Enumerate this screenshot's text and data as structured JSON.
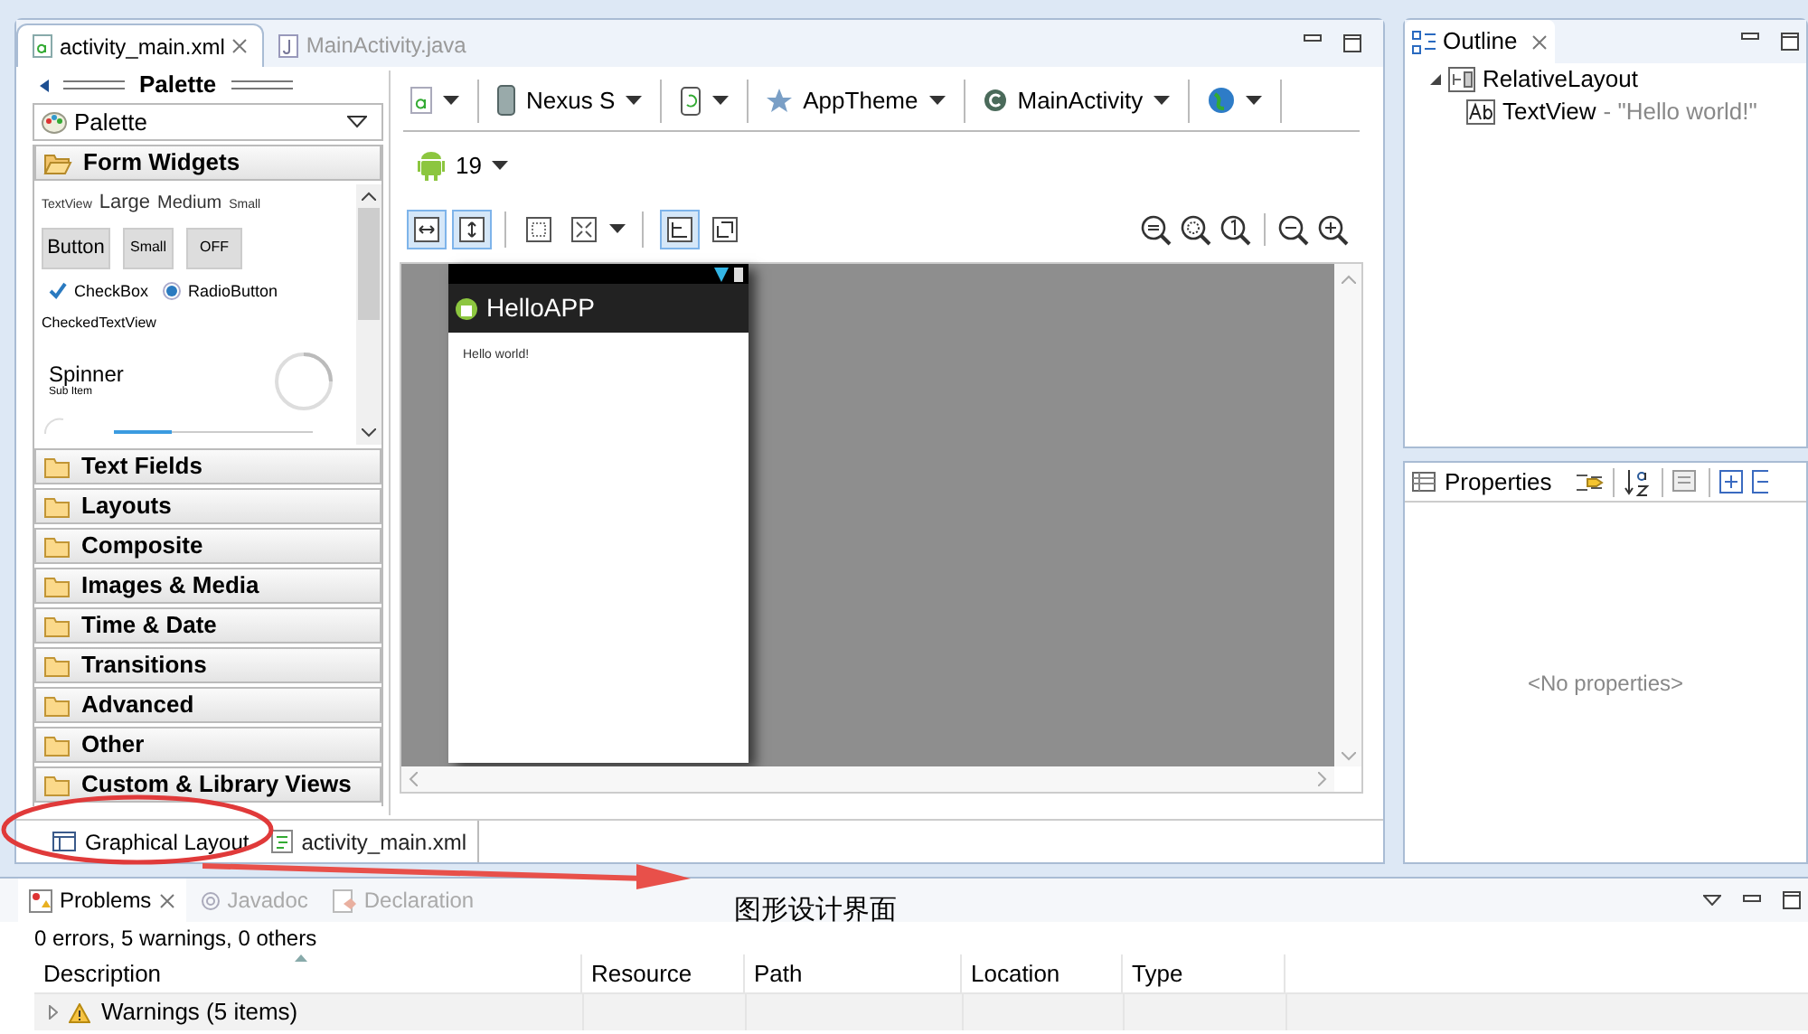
{
  "editor_tabs": [
    {
      "label": "activity_main.xml",
      "selected": true
    },
    {
      "label": "MainActivity.java",
      "selected": false
    }
  ],
  "palette": {
    "title": "Palette",
    "dropdown": "Palette",
    "form_widgets": {
      "text_sizes": [
        "TextView",
        "Large",
        "Medium",
        "Small"
      ],
      "buttons": [
        "Button",
        "Small",
        "OFF"
      ],
      "checkbox": {
        "label": "CheckBox",
        "checked": true
      },
      "radio": {
        "label": "RadioButton",
        "selected": true
      },
      "checked_text_view": "CheckedTextView",
      "spinner": "Spinner",
      "spinner_sub": "Sub Item"
    },
    "groups": [
      {
        "label": "Form Widgets",
        "expanded": true
      },
      {
        "label": "Text Fields",
        "expanded": false
      },
      {
        "label": "Layouts",
        "expanded": false
      },
      {
        "label": "Composite",
        "expanded": false
      },
      {
        "label": "Images & Media",
        "expanded": false
      },
      {
        "label": "Time & Date",
        "expanded": false
      },
      {
        "label": "Transitions",
        "expanded": false
      },
      {
        "label": "Advanced",
        "expanded": false
      },
      {
        "label": "Other",
        "expanded": false
      },
      {
        "label": "Custom & Library Views",
        "expanded": false
      }
    ]
  },
  "toolbar": {
    "device": "Nexus S",
    "theme": "AppTheme",
    "activity": "MainActivity",
    "api": "19"
  },
  "preview": {
    "app_title": "HelloAPP",
    "text": "Hello world!"
  },
  "bottom_tabs": [
    {
      "label": "Graphical Layout",
      "selected": true
    },
    {
      "label": "activity_main.xml",
      "selected": false
    }
  ],
  "outline": {
    "title": "Outline",
    "tree": [
      {
        "label": "RelativeLayout",
        "expanded": true,
        "children": [
          {
            "label": "TextView",
            "detail": "- \"Hello world!\""
          }
        ]
      }
    ]
  },
  "properties": {
    "title": "Properties",
    "empty": "<No properties>"
  },
  "problems": {
    "tabs": [
      {
        "label": "Problems",
        "selected": true
      },
      {
        "label": "Javadoc",
        "selected": false
      },
      {
        "label": "Declaration",
        "selected": false
      }
    ],
    "summary": "0 errors, 5 warnings, 0 others",
    "columns": [
      "Description",
      "Resource",
      "Path",
      "Location",
      "Type"
    ],
    "rows": [
      {
        "description": "Warnings (5 items)",
        "expanded": false
      }
    ]
  },
  "annotation": {
    "caption": "图形设计界面"
  }
}
